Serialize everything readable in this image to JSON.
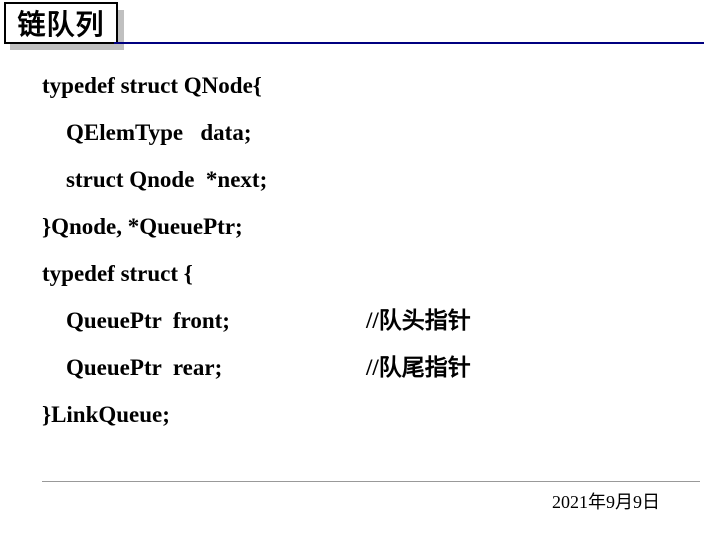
{
  "header": {
    "title": "链队列"
  },
  "code": {
    "l1": "typedef struct QNode{",
    "l2": "QElemType   data;",
    "l3": "struct Qnode  *next;",
    "l4": "}Qnode, *QueuePtr;",
    "l5": "typedef struct {",
    "l6_left": "QueuePtr  front;",
    "l6_right": "//队头指针",
    "l7_left": "QueuePtr  rear;",
    "l7_right": "//队尾指针",
    "l8": "}LinkQueue;"
  },
  "footer": {
    "date": "2021年9月9日"
  }
}
